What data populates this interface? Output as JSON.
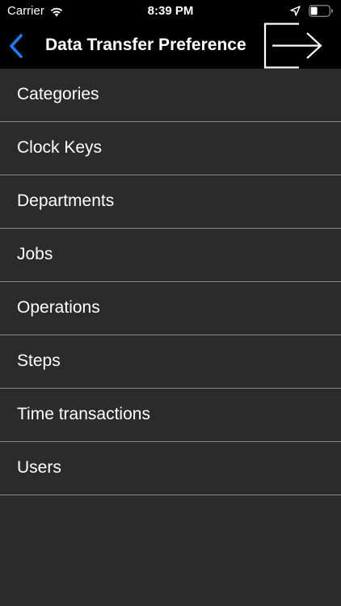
{
  "status_bar": {
    "carrier": "Carrier",
    "time": "8:39 PM"
  },
  "nav": {
    "title": "Data Transfer Preference",
    "back_icon": "chevron-left-icon",
    "action_icon": "export-arrow-icon",
    "accent_color": "#1a7cf5"
  },
  "list": {
    "items": [
      {
        "label": "Categories"
      },
      {
        "label": "Clock Keys"
      },
      {
        "label": "Departments"
      },
      {
        "label": "Jobs"
      },
      {
        "label": "Operations"
      },
      {
        "label": "Steps"
      },
      {
        "label": "Time transactions"
      },
      {
        "label": "Users"
      }
    ]
  },
  "colors": {
    "background": "#2b2b2b",
    "bar_background": "#000000",
    "separator": "#8a8a8a",
    "text": "#ffffff"
  }
}
